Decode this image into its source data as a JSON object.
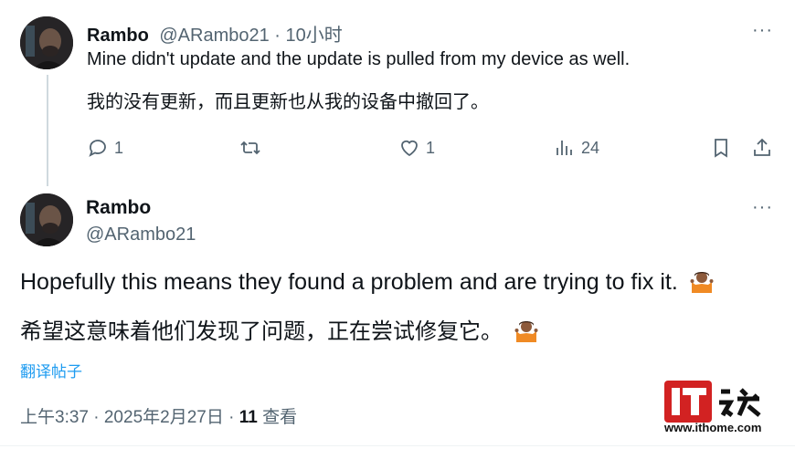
{
  "reply": {
    "name": "Rambo",
    "handle": "@ARambo21",
    "time": "· 10小时",
    "more": "···",
    "text_en": "Mine didn't update and the update is pulled from my device as well.",
    "text_zh": "我的没有更新，而且更新也从我的设备中撤回了。",
    "replies": "1",
    "likes": "1",
    "views": "24"
  },
  "post": {
    "name": "Rambo",
    "handle": "@ARambo21",
    "more": "···",
    "text_en": "Hopefully this means they found a problem and are trying to fix it.",
    "text_zh": "希望这意味着他们发现了问题，正在尝试修复它。",
    "translate": "翻译帖子",
    "time": "上午3:37 · 2025年2月27日 · ",
    "views": "11",
    "views_label": " 查看"
  },
  "watermark": {
    "logo_text": "IT之家",
    "url": "www.ithome.com",
    "brand_color": "#d22222"
  }
}
